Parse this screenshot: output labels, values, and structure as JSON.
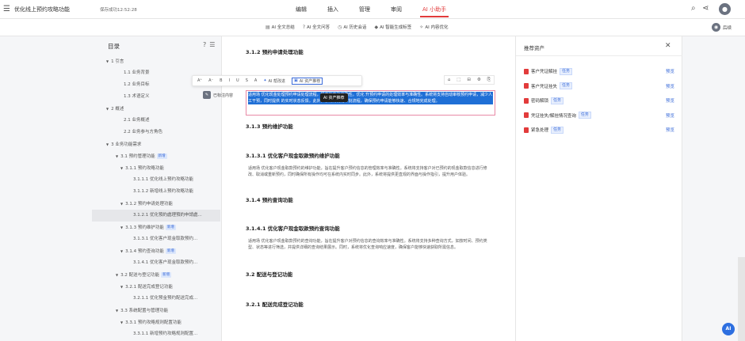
{
  "app": {
    "doc_title": "优化线上预约攻略功能",
    "save_status": "保存成功12:52:28",
    "menu_icon": "menu-icon",
    "tabs": [
      {
        "label": "编辑",
        "active": false
      },
      {
        "label": "插入",
        "active": false
      },
      {
        "label": "管理",
        "active": false
      },
      {
        "label": "审阅",
        "active": false
      },
      {
        "label": "AI 小助手",
        "active": true
      }
    ],
    "right_icons": [
      "search-icon",
      "share-icon",
      "avatar"
    ],
    "accent_color": "#e23b3b",
    "link_color": "#3a6bd9"
  },
  "toolbar": {
    "tools": [
      {
        "icon": "doc-summary-icon",
        "label": "AI 全文总结"
      },
      {
        "icon": "question-icon",
        "label": "AI 全文问答"
      },
      {
        "icon": "history-icon",
        "label": "AI 历史会话"
      },
      {
        "icon": "tag-icon",
        "label": "AI 智能生成标签"
      },
      {
        "icon": "optimize-icon",
        "label": "AI 内容优化"
      }
    ],
    "right_label": "后续"
  },
  "sidebar": {
    "title": "目录",
    "items": [
      {
        "label": "1 引言",
        "level": 1,
        "expandable": true
      },
      {
        "label": "1.1 业务背景",
        "level": 2
      },
      {
        "label": "1.2 业务目标",
        "level": 2
      },
      {
        "label": "1.3 术语定义",
        "level": 2
      },
      {
        "label": "2 概述",
        "level": 1,
        "expandable": true
      },
      {
        "label": "2.1 业务概述",
        "level": 2
      },
      {
        "label": "2.2 业务参与方角色",
        "level": 2
      },
      {
        "label": "3 业务功能需求",
        "level": 1,
        "expandable": true
      },
      {
        "label": "3.1 预约管理功能",
        "level": 2,
        "expandable": true,
        "badge": "新增"
      },
      {
        "label": "3.1.1 预约攻略功能",
        "level": 3,
        "expandable": true
      },
      {
        "label": "3.1.1.1 优化线上预约攻略功能",
        "level": 4
      },
      {
        "label": "3.1.1.2 新增线上预约攻略功能",
        "level": 4
      },
      {
        "label": "3.1.2 预约申请处理功能",
        "level": 3,
        "expandable": true
      },
      {
        "label": "3.1.2.1 优化預約處理預約申請處...",
        "level": 4,
        "active": true
      },
      {
        "label": "3.1.3 预约维护功能",
        "level": 3,
        "expandable": true,
        "badge": "新增"
      },
      {
        "label": "3.1.3.1 优化客户现金取款预约...",
        "level": 4
      },
      {
        "label": "3.1.4 预约查询功能",
        "level": 3,
        "expandable": true,
        "badge": "新增"
      },
      {
        "label": "3.1.4.1 优化客户现金取款预约...",
        "level": 4
      },
      {
        "label": "3.2 配送与登记功能",
        "level": 2,
        "expandable": true,
        "badge": "新增"
      },
      {
        "label": "3.2.1 配送完成登记功能",
        "level": 3,
        "expandable": true
      },
      {
        "label": "3.2.1.1 优化预金预约配送完成...",
        "level": 4
      },
      {
        "label": "3.3 系统配置与管理功能",
        "level": 2,
        "expandable": true
      },
      {
        "label": "3.3.1 预约攻略规则配置功能",
        "level": 3,
        "expandable": true
      },
      {
        "label": "3.3.1.1 新增预约攻略规则配置...",
        "level": 4
      }
    ]
  },
  "document": {
    "h1": "3.1.2 预约申请处理功能",
    "selected_text": "适用场 优化现金处理预约申请处理流程，提高效率和准确性。优化 升预约申请的处理效率与准确性。系统将支持自动审核预约申请，减少人工干预，同时提供 的实时状态反馈。此外，系统将优化审批流程，确保预约申请能够快速、合规地完成处理。",
    "h2": "3.1.3 预约维护功能",
    "h3": "3.1.3.1 优化客户现金取款预约维护功能",
    "p3": "适用场 优化客户现金取款预约的维护功能，旨在提升客户预约信息的管理效率与准确性。系统将支持客户对已预约的现金取款信息进行修改、取消或重新预约，同时确保所有操作均可在系统内实时同步。此外，系统将提供更直观的界面与操作指引，提升用户体验。",
    "h4": "3.1.4 预约查询功能",
    "h5": "3.1.4.1 优化客户现金取款预约查询功能",
    "p5": "适用场 优化客户现金取款预约的查询功能，旨在提升客户对预约信息的查询效率与准确性。系统将支持多种查询方式，如按时间、预约类型、状态等进行筛选，并提供详细的查询结果展示。同时，系统将优化查询响应速度，确保客户能够快速获取所需信息。",
    "h6": "3.2 配送与登记功能",
    "h7": "3.2.1 配送完成登记功能"
  },
  "float_toolbar": {
    "format_glyphs": [
      "A⁺",
      "A⁻",
      "B",
      "I",
      "U",
      "S",
      "A"
    ],
    "ai_polish": "AI 帮改进",
    "ai_assets": "AI 资产推荐",
    "tooltip": "AI 资产推荐",
    "side_chip": "已标注内容"
  },
  "mini_toolbar": {
    "glyphs": [
      "⌂",
      "⬚",
      "⊟",
      "⚙",
      "⎘"
    ]
  },
  "right_panel": {
    "title": "推荐资产",
    "preview_label": "预览",
    "assets": [
      {
        "name": "客户凭证解挂",
        "tag": "任务"
      },
      {
        "name": "客户凭证挂失",
        "tag": "任务"
      },
      {
        "name": "密码解锁",
        "tag": "任务"
      },
      {
        "name": "凭证挂失/解挂情况查询",
        "tag": "任务"
      },
      {
        "name": "紧急处理",
        "tag": "任务"
      }
    ]
  },
  "fab": {
    "label": "AI"
  }
}
